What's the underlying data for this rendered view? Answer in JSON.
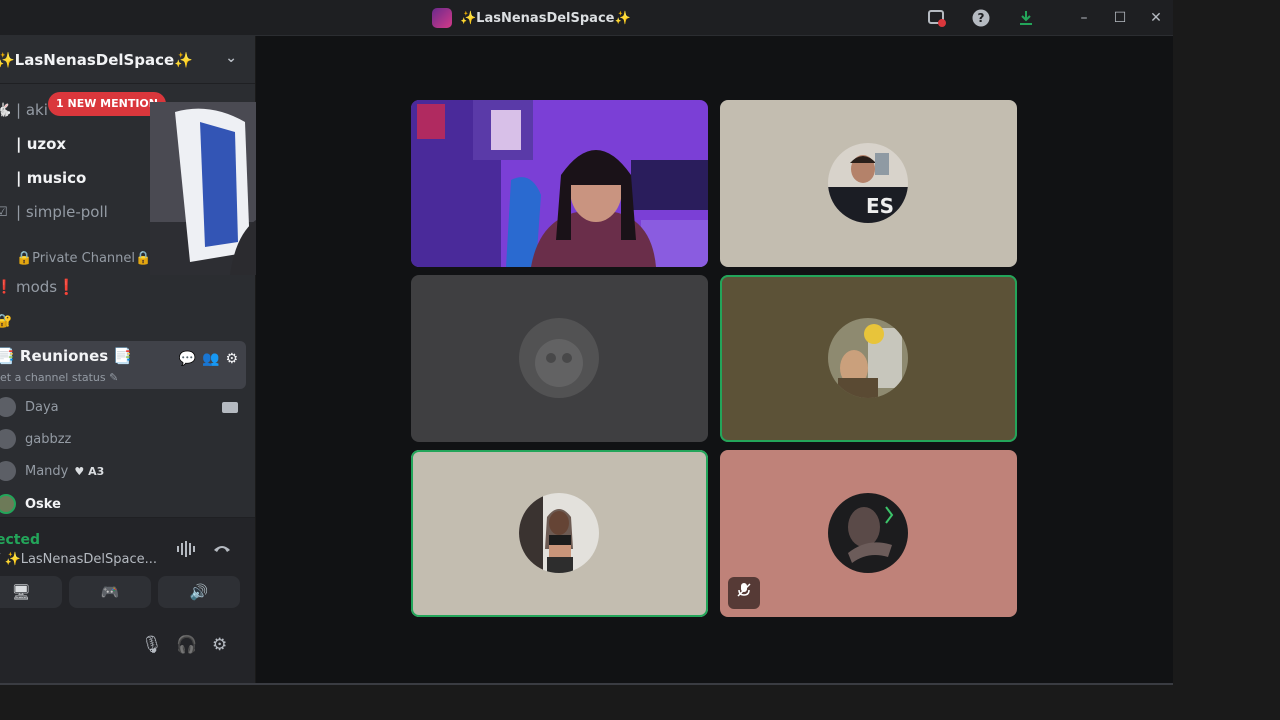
{
  "window": {
    "title": "✨LasNenasDelSpace✨",
    "server_logo_icon": "server-logo",
    "controls": [
      "minimize",
      "maximize",
      "close"
    ]
  },
  "sidebar": {
    "server_name": "✨LasNenasDelSpace✨",
    "new_mention": "1 NEW MENTION",
    "channels": [
      {
        "prefix": "🐇",
        "label": "| aki",
        "bold": false
      },
      {
        "prefix": "",
        "label": "| uzox",
        "bold": true
      },
      {
        "prefix": "",
        "label": "| musico",
        "bold": true
      },
      {
        "prefix": "☑",
        "label": "| simple-poll",
        "bold": false
      },
      {
        "prefix": "·",
        "label": "🔒Private Channel🔒",
        "bold": false
      },
      {
        "prefix": "❗",
        "label": "mods❗",
        "bold": false
      },
      {
        "prefix": "🔐",
        "label": "",
        "bold": false
      }
    ],
    "voice_channel": {
      "name": "📑 Reuniones 📑",
      "status": "et a channel status"
    },
    "members": [
      {
        "name": "Daya"
      },
      {
        "name": "gabbzz"
      },
      {
        "name": "Mandy",
        "badge": "A3"
      },
      {
        "name": "Oske"
      }
    ]
  },
  "voice_panel": {
    "status": "ected",
    "channel": "/ ✨LasNenasDelSpace..."
  },
  "stage": {
    "tiles": [
      {
        "kind": "video",
        "speaking": false,
        "muted": false
      },
      {
        "kind": "avatar",
        "bg": "#c3bdb0",
        "speaking": false,
        "muted": false
      },
      {
        "kind": "avatar",
        "bg": "#3f3f41",
        "speaking": false,
        "muted": false
      },
      {
        "kind": "avatar",
        "bg": "#5c5237",
        "speaking": true,
        "muted": false
      },
      {
        "kind": "avatar",
        "bg": "#c3bdb0",
        "speaking": true,
        "muted": false
      },
      {
        "kind": "avatar",
        "bg": "#bf8279",
        "speaking": false,
        "muted": true
      }
    ]
  },
  "colors": {
    "accent_green": "#23a55a",
    "mention_red": "#da373c",
    "sidebar_bg": "#2b2d31",
    "stage_bg": "#111214"
  }
}
